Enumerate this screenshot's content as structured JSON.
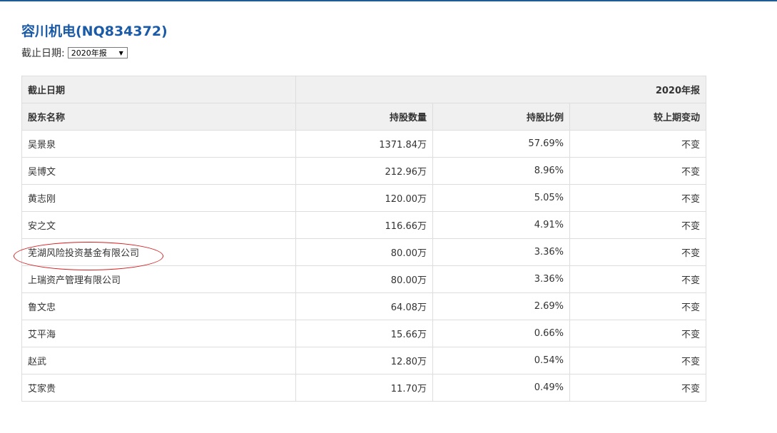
{
  "page": {
    "title": "容川机电(NQ834372)"
  },
  "date_filter": {
    "label": "截止日期:",
    "selected": "2020年报",
    "arrow": "▼"
  },
  "table": {
    "header_row1": {
      "label": "截止日期",
      "period": "2020年报"
    },
    "columns": [
      "股东名称",
      "持股数量",
      "持股比例",
      "较上期变动"
    ],
    "rows": [
      {
        "name": "吴景泉",
        "shares": "1371.84万",
        "ratio": "57.69%",
        "change": "不变"
      },
      {
        "name": "吴博文",
        "shares": "212.96万",
        "ratio": "8.96%",
        "change": "不变"
      },
      {
        "name": "黄志刚",
        "shares": "120.00万",
        "ratio": "5.05%",
        "change": "不变"
      },
      {
        "name": "安之文",
        "shares": "116.66万",
        "ratio": "4.91%",
        "change": "不变"
      },
      {
        "name": "芜湖风险投资基金有限公司",
        "shares": "80.00万",
        "ratio": "3.36%",
        "change": "不变"
      },
      {
        "name": "上瑞资产管理有限公司",
        "shares": "80.00万",
        "ratio": "3.36%",
        "change": "不变"
      },
      {
        "name": "鲁文忠",
        "shares": "64.08万",
        "ratio": "2.69%",
        "change": "不变"
      },
      {
        "name": "艾平海",
        "shares": "15.66万",
        "ratio": "0.66%",
        "change": "不变"
      },
      {
        "name": "赵武",
        "shares": "12.80万",
        "ratio": "0.54%",
        "change": "不变"
      },
      {
        "name": "艾家贵",
        "shares": "11.70万",
        "ratio": "0.49%",
        "change": "不变"
      }
    ]
  },
  "annotation": {
    "color": "#d81e1e"
  },
  "colors": {
    "title": "#1a5aa6",
    "top_line": "#1f5c97",
    "header_bg": "#f0f0f0",
    "border": "#dddddd"
  }
}
